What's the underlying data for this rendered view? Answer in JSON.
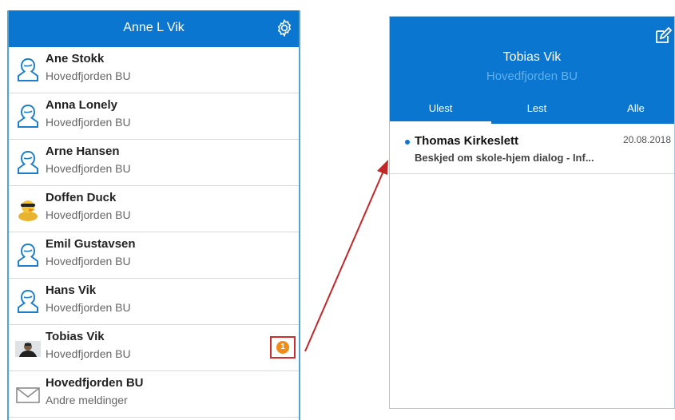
{
  "left": {
    "title": "Anne L Vik",
    "header_icon": "gear-icon",
    "contacts": [
      {
        "name": "Ane Stokk",
        "sub": "Hovedfjorden BU",
        "avatar": "person-outline-icon"
      },
      {
        "name": "Anna Lonely",
        "sub": "Hovedfjorden BU",
        "avatar": "person-outline-icon"
      },
      {
        "name": "Arne Hansen",
        "sub": "Hovedfjorden BU",
        "avatar": "person-outline-icon"
      },
      {
        "name": "Doffen Duck",
        "sub": "Hovedfjorden BU",
        "avatar": "duck-avatar"
      },
      {
        "name": "Emil Gustavsen",
        "sub": "Hovedfjorden BU",
        "avatar": "person-outline-icon"
      },
      {
        "name": "Hans Vik",
        "sub": "Hovedfjorden BU",
        "avatar": "person-outline-icon"
      },
      {
        "name": "Tobias Vik",
        "sub": "Hovedfjorden BU",
        "avatar": "photo-avatar",
        "badge": "1"
      },
      {
        "name": "Hovedfjorden BU",
        "sub": "Andre meldinger",
        "avatar": "envelope-icon"
      }
    ]
  },
  "right": {
    "name": "Tobias Vik",
    "subtitle": "Hovedfjorden BU",
    "header_icon": "compose-icon",
    "tabs": [
      "Ulest",
      "Lest",
      "Alle"
    ],
    "active_tab": "Ulest",
    "messages": [
      {
        "from": "Thomas Kirkeslett",
        "date": "20.08.2018",
        "subject": "Beskjed om skole-hjem dialog - Inf..."
      }
    ]
  },
  "colors": {
    "brand_blue": "#0a76cf",
    "badge_orange": "#f28c18",
    "highlight_red": "#d22c2c"
  }
}
